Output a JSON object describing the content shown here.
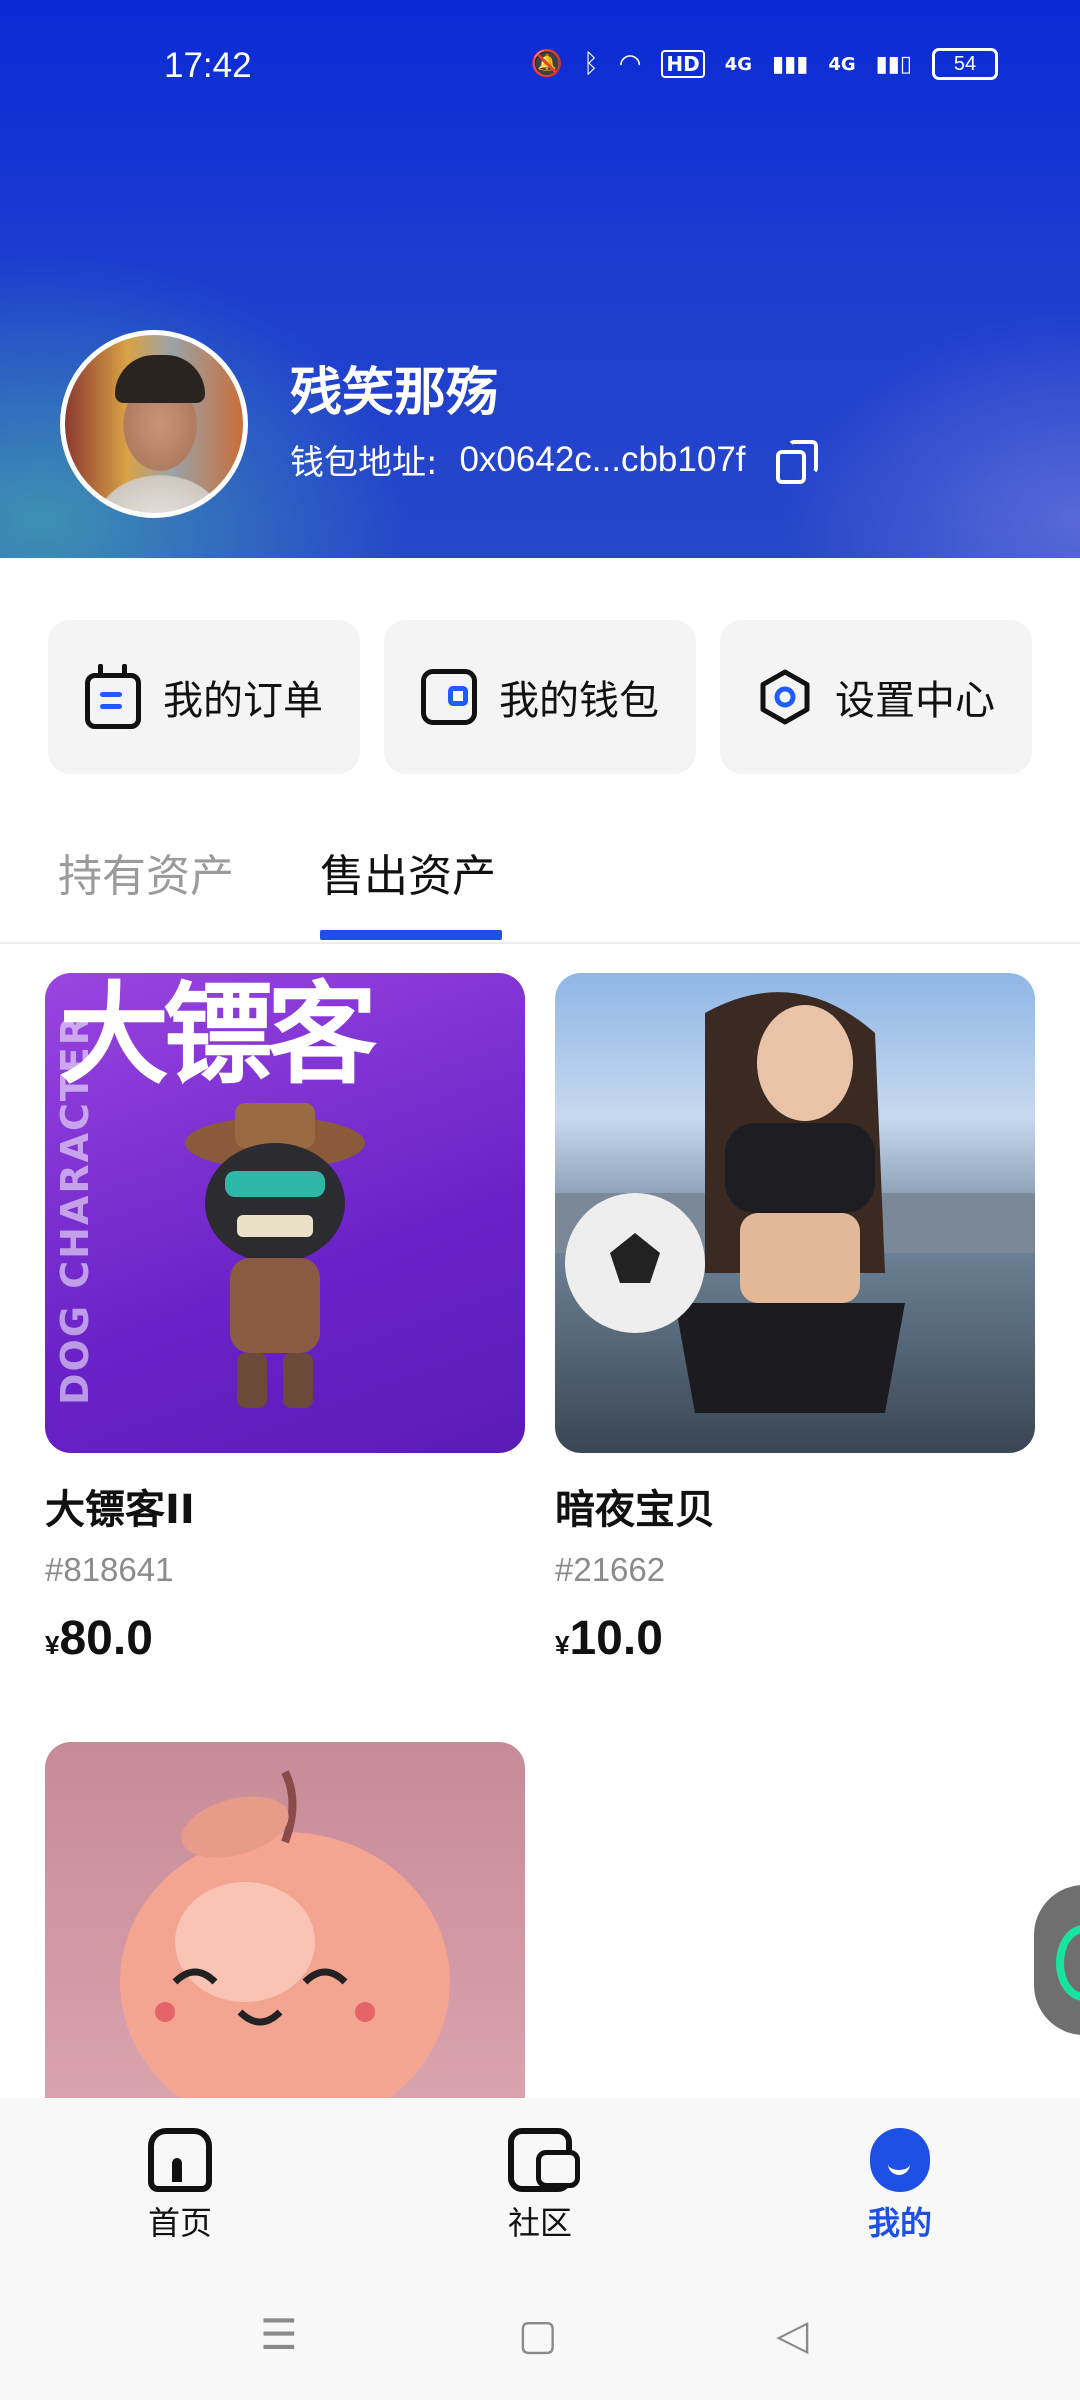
{
  "status_bar": {
    "time": "17:42",
    "icons": [
      "mute-bell-icon",
      "bluetooth-icon",
      "wifi-icon",
      "hd-icon",
      "signal-4g-icon",
      "signal-4g-icon"
    ],
    "hd_label": "HD",
    "net_label_1": "4G",
    "net_label_2": "4G",
    "battery": "54"
  },
  "profile": {
    "username": "残笑那殇",
    "wallet_label": "钱包地址:",
    "wallet_address": "0x0642c...cbb107f"
  },
  "quick_actions": [
    {
      "label": "我的订单",
      "icon": "order-icon"
    },
    {
      "label": "我的钱包",
      "icon": "wallet-icon"
    },
    {
      "label": "设置中心",
      "icon": "settings-icon"
    }
  ],
  "tabs": [
    {
      "label": "持有资产",
      "active": false
    },
    {
      "label": "售出资产",
      "active": true
    }
  ],
  "assets": [
    {
      "title": "大镖客II",
      "code": "#818641",
      "currency": "¥",
      "price": "80.0",
      "thumb_text": "大镖客",
      "thumb_side_text": "DOG CHARACTER"
    },
    {
      "title": "暗夜宝贝",
      "code": "#21662",
      "currency": "¥",
      "price": "10.0"
    },
    {
      "title": "",
      "code": "",
      "currency": "",
      "price": ""
    }
  ],
  "bottom_nav": [
    {
      "label": "首页",
      "icon": "home-icon",
      "active": false
    },
    {
      "label": "社区",
      "icon": "chat-icon",
      "active": false
    },
    {
      "label": "我的",
      "icon": "profile-icon",
      "active": true
    }
  ],
  "colors": {
    "accent": "#1e50e6",
    "hero_top": "#0a2ad6",
    "card_bg": "#f4f4f5"
  }
}
